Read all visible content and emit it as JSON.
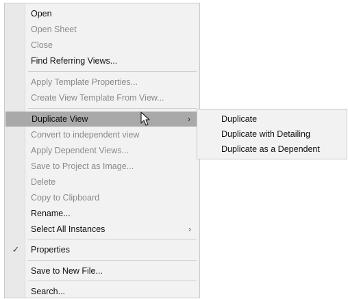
{
  "context_menu": {
    "items": [
      {
        "label": "Open",
        "enabled": true
      },
      {
        "label": "Open Sheet",
        "enabled": false
      },
      {
        "label": "Close",
        "enabled": false
      },
      {
        "label": "Find Referring Views...",
        "enabled": true
      },
      {
        "label": "Apply Template Properties...",
        "enabled": false
      },
      {
        "label": "Create View Template From View...",
        "enabled": false
      },
      {
        "label": "Duplicate View",
        "enabled": true,
        "highlighted": true,
        "has_submenu": true,
        "submenu_arrow": "›"
      },
      {
        "label": "Convert to independent view",
        "enabled": false
      },
      {
        "label": "Apply Dependent Views...",
        "enabled": false
      },
      {
        "label": "Save to Project as Image...",
        "enabled": false
      },
      {
        "label": "Delete",
        "enabled": false
      },
      {
        "label": "Copy to Clipboard",
        "enabled": false
      },
      {
        "label": "Rename...",
        "enabled": true
      },
      {
        "label": "Select All Instances",
        "enabled": true,
        "has_submenu": true,
        "submenu_arrow": "›"
      },
      {
        "label": "Properties",
        "enabled": true,
        "checked": true,
        "check_glyph": "✓"
      },
      {
        "label": "Save to New File...",
        "enabled": true
      },
      {
        "label": "Search...",
        "enabled": true
      }
    ]
  },
  "submenu": {
    "items": [
      {
        "label": "Duplicate"
      },
      {
        "label": "Duplicate with Detailing"
      },
      {
        "label": "Duplicate as a Dependent"
      }
    ]
  },
  "colors": {
    "menu_background": "#f2f2f2",
    "highlight": "#a9a9a9",
    "disabled_text": "#8a8a8a",
    "text": "#111111"
  },
  "icons": {
    "cursor": "mouse-pointer-icon",
    "check": "checkmark-icon",
    "submenu_arrow": "chevron-right-icon"
  }
}
